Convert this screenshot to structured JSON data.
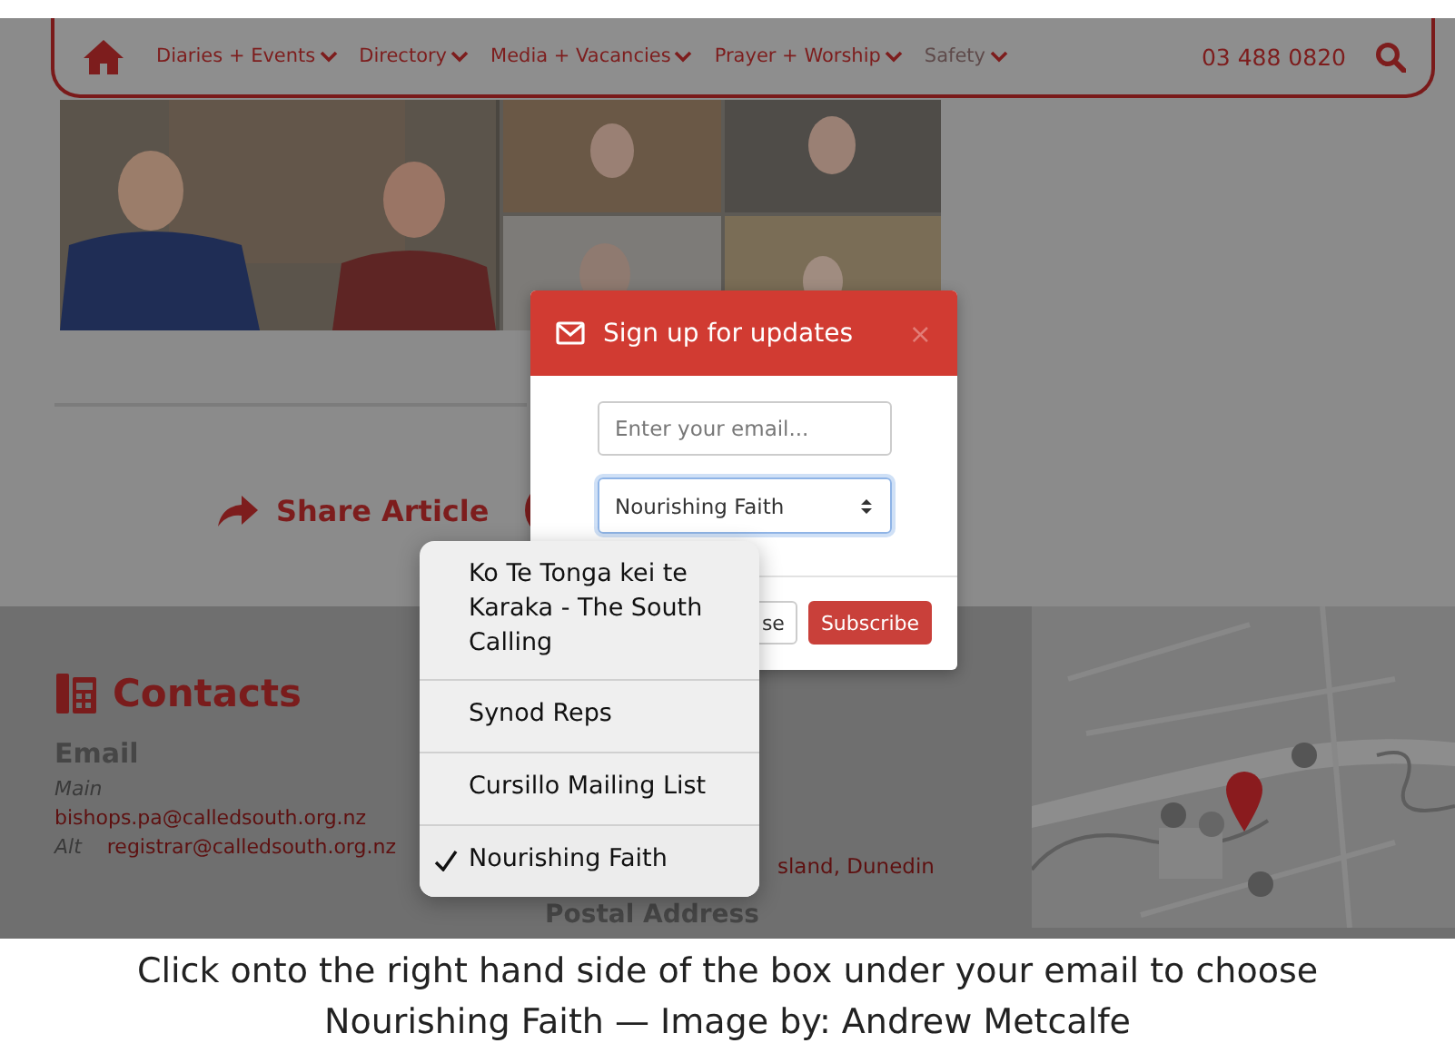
{
  "navbar": {
    "items": [
      {
        "label": "Diaries + Events",
        "faded": false
      },
      {
        "label": "Directory",
        "faded": false
      },
      {
        "label": "Media + Vacancies",
        "faded": false
      },
      {
        "label": "Prayer + Worship",
        "faded": false
      },
      {
        "label": "Safety",
        "faded": true
      }
    ],
    "phone": "03 488 0820"
  },
  "article": {
    "share_label": "Share Article"
  },
  "contacts": {
    "title": "Contacts",
    "email_heading": "Email",
    "entries": [
      {
        "label": "Main",
        "value": "bishops.pa@calledsouth.org.nz"
      },
      {
        "label": "Alt",
        "value": "registrar@calledsouth.org.nz"
      }
    ],
    "address_fragment": "sland, Dunedin",
    "postal_heading": "Postal Address"
  },
  "modal": {
    "title": "Sign up for updates",
    "close": "×",
    "email_placeholder": "Enter your email...",
    "select_value": "Nourishing Faith",
    "buttons": [
      {
        "label": "se",
        "kind": "secondary"
      },
      {
        "label": "Subscribe",
        "kind": "primary"
      }
    ]
  },
  "dropdown": {
    "options": [
      {
        "label": "Ko Te Tonga kei te Karaka - The South Calling",
        "selected": false
      },
      {
        "label": "Synod Reps",
        "selected": false
      },
      {
        "label": "Cursillo Mailing List",
        "selected": false
      },
      {
        "label": "Nourishing Faith",
        "selected": true
      }
    ]
  },
  "caption": {
    "text": "Click onto the right hand side of the box under your email to choose Nourishing Faith — Image by: Andrew Metcalfe"
  }
}
